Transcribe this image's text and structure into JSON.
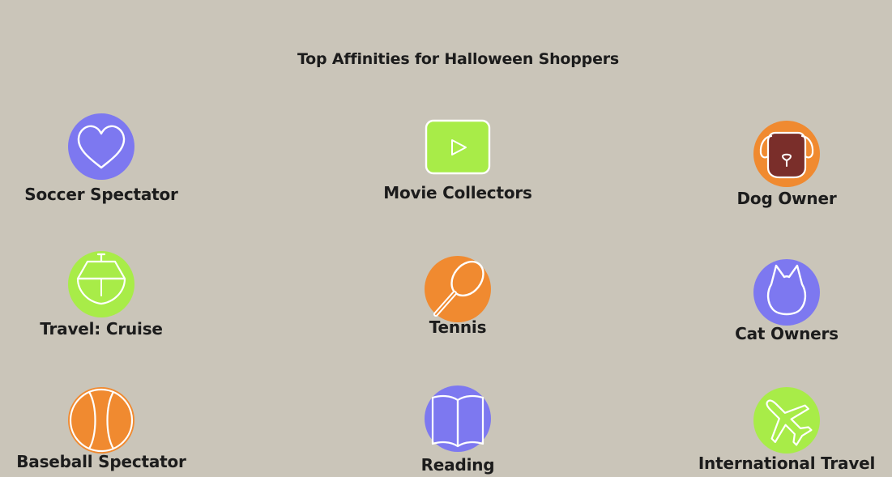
{
  "title": "Top Affinities for Halloween Shoppers",
  "colors": {
    "background": "#CAC5B9",
    "purple": "#7D78F0",
    "green": "#A8EC48",
    "orange": "#F08A30",
    "dog_face": "#7A2E2A"
  },
  "affinities": [
    {
      "label": "Soccer Spectator",
      "icon": "heart-icon",
      "color": "#7D78F0"
    },
    {
      "label": "Movie Collectors",
      "icon": "play-button-icon",
      "color": "#A8EC48"
    },
    {
      "label": "Dog Owner",
      "icon": "dog-icon",
      "color": "#F08A30"
    },
    {
      "label": "Travel: Cruise",
      "icon": "ship-icon",
      "color": "#A8EC48"
    },
    {
      "label": "Tennis",
      "icon": "tennis-racket-icon",
      "color": "#F08A30"
    },
    {
      "label": "Cat Owners",
      "icon": "cat-icon",
      "color": "#7D78F0"
    },
    {
      "label": "Baseball Spectator",
      "icon": "ball-icon",
      "color": "#F08A30"
    },
    {
      "label": "Reading",
      "icon": "book-icon",
      "color": "#7D78F0"
    },
    {
      "label": "International Travel",
      "icon": "airplane-icon",
      "color": "#A8EC48"
    }
  ]
}
